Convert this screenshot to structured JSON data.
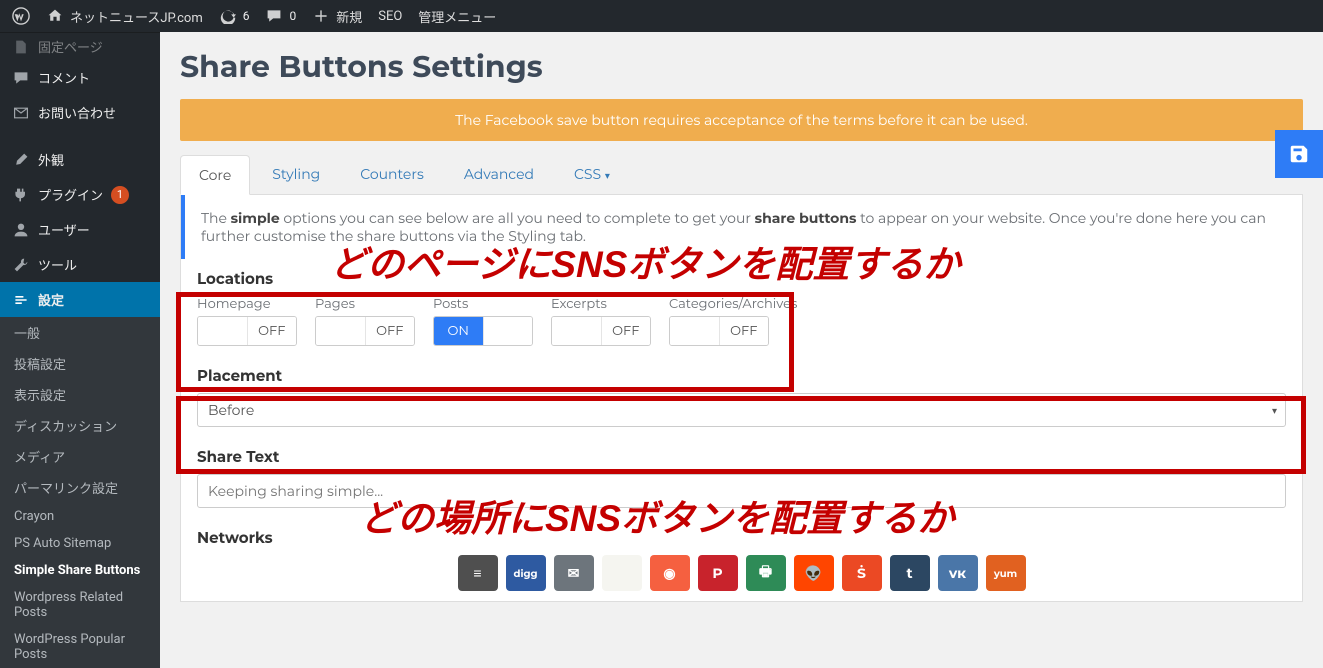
{
  "adminbar": {
    "site_name": "ネットニュースJP.com",
    "updates": "6",
    "comments": "0",
    "new": "新規",
    "seo": "SEO",
    "manage": "管理メニュー"
  },
  "sidebar": {
    "items": [
      {
        "label": "固定ページ"
      },
      {
        "label": "コメント"
      },
      {
        "label": "お問い合わせ"
      },
      {
        "label": "外観"
      },
      {
        "label": "プラグイン",
        "badge": "1"
      },
      {
        "label": "ユーザー"
      },
      {
        "label": "ツール"
      },
      {
        "label": "設定"
      }
    ],
    "sub": [
      "一般",
      "投稿設定",
      "表示設定",
      "ディスカッション",
      "メディア",
      "パーマリンク設定",
      "Crayon",
      "PS Auto Sitemap",
      "Simple Share Buttons",
      "Wordpress Related Posts",
      "WordPress Popular Posts"
    ],
    "sub_active_index": 8
  },
  "page": {
    "title": "Share Buttons Settings",
    "notice": "The Facebook save button requires acceptance of the terms before it can be used."
  },
  "tabs": [
    "Core",
    "Styling",
    "Counters",
    "Advanced",
    "CSS"
  ],
  "tabs_active_index": 0,
  "help": {
    "pre": "The ",
    "b1": "simple",
    "mid1": " options you can see below are all you need to complete to get your ",
    "b2": "share buttons",
    "mid2": " to appear on your website. Once you're done here you can further customise the share buttons via the Styling tab."
  },
  "locations": {
    "heading": "Locations",
    "items": [
      {
        "label": "Homepage",
        "state": "OFF"
      },
      {
        "label": "Pages",
        "state": "OFF"
      },
      {
        "label": "Posts",
        "state": "ON"
      },
      {
        "label": "Excerpts",
        "state": "OFF"
      },
      {
        "label": "Categories/Archives",
        "state": "OFF"
      }
    ]
  },
  "placement": {
    "heading": "Placement",
    "value": "Before"
  },
  "share_text": {
    "heading": "Share Text",
    "placeholder": "Keeping sharing simple..."
  },
  "networks": {
    "heading": "Networks",
    "items": [
      {
        "name": "buffer",
        "color": "#4f4f4f",
        "letter": "≡"
      },
      {
        "name": "digg",
        "color": "#2e5aa1",
        "letter": "digg"
      },
      {
        "name": "email",
        "color": "#6d757c",
        "letter": "✉"
      },
      {
        "name": "flattr",
        "color": "#f5f5f0",
        "letter": " "
      },
      {
        "name": "flipboard",
        "color": "#f56040",
        "letter": "◉"
      },
      {
        "name": "pinterest",
        "color": "#c8232c",
        "letter": "P"
      },
      {
        "name": "print",
        "color": "#2e8b57",
        "letter": "🖶"
      },
      {
        "name": "reddit",
        "color": "#ff4500",
        "letter": "👽"
      },
      {
        "name": "stumble",
        "color": "#eb4924",
        "letter": "Ṡ"
      },
      {
        "name": "tumblr",
        "color": "#2c4762",
        "letter": "t"
      },
      {
        "name": "vk",
        "color": "#4a76a8",
        "letter": "vк"
      },
      {
        "name": "yummly",
        "color": "#e16120",
        "letter": "yum"
      }
    ]
  },
  "annotations": {
    "a1": "どのページにSNSボタンを配置するか",
    "a2": "どの場所にSNSボタンを配置するか"
  },
  "toggle_labels": {
    "on": "ON",
    "off": "OFF"
  }
}
